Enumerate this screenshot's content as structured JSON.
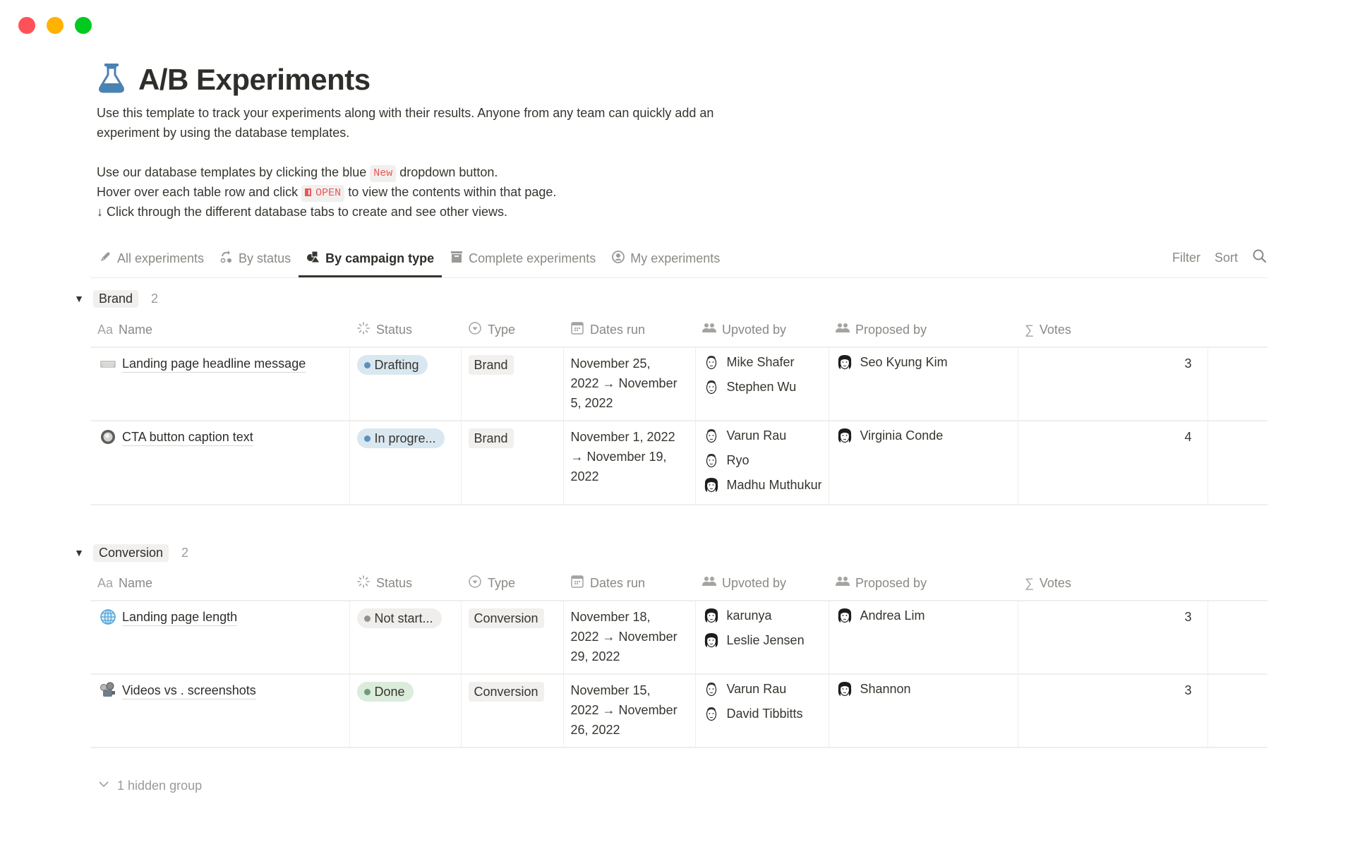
{
  "window": {
    "controls": [
      "close",
      "minimize",
      "maximize"
    ],
    "colors": {
      "close": "#ff5257",
      "minimize": "#ffb200",
      "maximize": "#00c920"
    }
  },
  "page": {
    "icon": "flask-icon",
    "title": "A/B Experiments",
    "description": [
      "Use this template to track your experiments along with their results. Anyone from any team can quickly add an",
      "experiment by using the database templates."
    ],
    "help": {
      "line1_before": "Use our database templates by clicking the blue",
      "line1_code": "New",
      "line1_after": "dropdown button.",
      "line2_before": "Hover over each table row and click",
      "line2_code": "OPEN",
      "line2_after": "to view the contents within that page.",
      "line3": "↓ Click through the different database tabs to create and see other views."
    }
  },
  "tabs": [
    {
      "label": "All experiments",
      "icon": "pencil-icon",
      "active": false
    },
    {
      "label": "By status",
      "icon": "workflow-icon",
      "active": false
    },
    {
      "label": "By campaign type",
      "icon": "shapes-icon",
      "active": true
    },
    {
      "label": "Complete experiments",
      "icon": "archive-icon",
      "active": false
    },
    {
      "label": "My experiments",
      "icon": "user-circle-icon",
      "active": false
    }
  ],
  "view_actions": {
    "filter": "Filter",
    "sort": "Sort",
    "search_icon": "search-icon"
  },
  "columns": [
    {
      "label": "Name",
      "icon": "text-icon",
      "icon_text": "Aa"
    },
    {
      "label": "Status",
      "icon": "status-icon"
    },
    {
      "label": "Type",
      "icon": "select-icon"
    },
    {
      "label": "Dates run",
      "icon": "calendar-icon"
    },
    {
      "label": "Upvoted by",
      "icon": "people-icon"
    },
    {
      "label": "Proposed by",
      "icon": "people-icon"
    },
    {
      "label": "Votes",
      "icon": "sigma-icon",
      "icon_text": "∑"
    }
  ],
  "status_colors": {
    "Drafting": {
      "bg": "#d9e7f0",
      "dot": "#5b90bf"
    },
    "In progress": {
      "bg": "#d9e7f0",
      "dot": "#5b90bf"
    },
    "Not started": {
      "bg": "#efeeec",
      "dot": "#91918e"
    },
    "Done": {
      "bg": "#dbecdb",
      "dot": "#6c9b7d"
    }
  },
  "groups": [
    {
      "label": "Brand",
      "count": "2",
      "rows": [
        {
          "icon": "keyboard-icon",
          "name": "Landing page headline message",
          "status": "Drafting",
          "status_key": "Drafting",
          "type": "Brand",
          "dates": [
            "November 25,",
            "2022 → November",
            "5, 2022"
          ],
          "upvoted_by": [
            "Mike Shafer",
            "Stephen Wu"
          ],
          "proposed_by": [
            "Seo Kyung Kim"
          ],
          "votes": "3"
        },
        {
          "icon": "radio-button-icon",
          "name": "CTA button caption text",
          "status": "In progre...",
          "status_key": "In progress",
          "type": "Brand",
          "dates": [
            "November 1, 2022",
            "→ November 19,",
            "2022"
          ],
          "upvoted_by": [
            "Varun Rau",
            "Ryo",
            "Madhu Muthukur"
          ],
          "proposed_by": [
            "Virginia Conde"
          ],
          "votes": "4"
        }
      ]
    },
    {
      "label": "Conversion",
      "count": "2",
      "rows": [
        {
          "icon": "globe-icon",
          "name": "Landing page length",
          "status": "Not start...",
          "status_key": "Not started",
          "type": "Conversion",
          "dates": [
            "November 18,",
            "2022 → November",
            "29, 2022"
          ],
          "upvoted_by": [
            "karunya",
            "Leslie Jensen"
          ],
          "proposed_by": [
            "Andrea Lim"
          ],
          "votes": "3"
        },
        {
          "icon": "film-projector-icon",
          "name": "Videos vs . screenshots",
          "status": "Done",
          "status_key": "Done",
          "type": "Conversion",
          "dates": [
            "November 15,",
            "2022 → November",
            "26, 2022"
          ],
          "upvoted_by": [
            "Varun Rau",
            "David Tibbitts"
          ],
          "proposed_by": [
            "Shannon"
          ],
          "votes": "3"
        }
      ]
    }
  ],
  "hidden_groups": "1 hidden group"
}
